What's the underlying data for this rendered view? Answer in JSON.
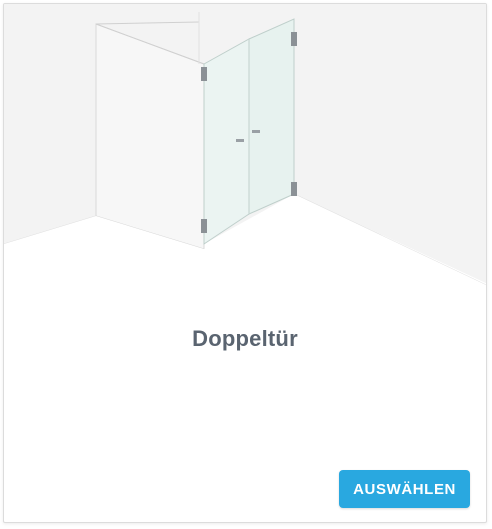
{
  "card": {
    "title": "Doppeltür",
    "select_label": "AUSWÄHLEN",
    "illustration_icon": "glass-double-door-shower-icon"
  },
  "colors": {
    "accent": "#29a8e0",
    "title_text": "#5a6470",
    "button_text": "#ffffff"
  }
}
